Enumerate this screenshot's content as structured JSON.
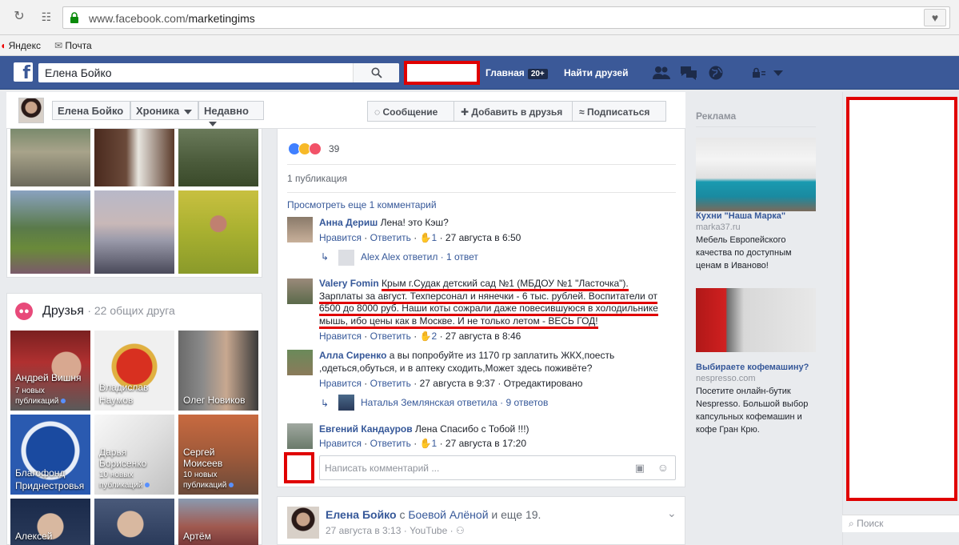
{
  "browser": {
    "url_prefix": "www.facebook.com/",
    "url_path": "marketingims",
    "bookmarks": [
      "Яндекс",
      "Почта"
    ]
  },
  "fb": {
    "search_value": "Елена Бойко",
    "nav_home": "Главная",
    "nav_home_badge": "20+",
    "nav_find_friends": "Найти друзей"
  },
  "profile": {
    "name": "Елена Бойко",
    "timeline_label": "Хроника",
    "recent_label": "Недавно",
    "message_btn": "Сообщение",
    "add_friend_btn": "Добавить в друзья",
    "follow_btn": "Подписаться"
  },
  "friends": {
    "title": "Друзья",
    "common": "· 22 общих друга",
    "tiles": [
      {
        "name": "Андрей Вишня",
        "sub1": "7 новых",
        "sub2": "публикаций"
      },
      {
        "name": "Владислав",
        "name2": "Наумов",
        "sub1": "",
        "sub2": ""
      },
      {
        "name": "Олег Новиков",
        "sub1": "",
        "sub2": ""
      },
      {
        "name": "Благофонд",
        "name2": "Приднестровья",
        "sub1": "",
        "sub2": ""
      },
      {
        "name": "Дарья",
        "name2": "Борисенко",
        "sub1": "10 новых",
        "sub2": "публикаций"
      },
      {
        "name": "Сергей",
        "name2": "Моисеев",
        "sub1": "10 новых",
        "sub2": "публикаций"
      },
      {
        "name": "Алексей",
        "sub1": "",
        "sub2": ""
      },
      {
        "name": "",
        "sub1": "",
        "sub2": ""
      },
      {
        "name": "Артём",
        "sub1": "",
        "sub2": ""
      }
    ]
  },
  "post": {
    "reactions_count": "39",
    "shares": "1 публикация",
    "view_more": "Просмотреть еще 1 комментарий",
    "comments": [
      {
        "author": "Анна Дериш",
        "text": "Лена! это Кэш?",
        "meta_like": "Нравится",
        "meta_reply": "Ответить",
        "likes": "1",
        "time": "27 августа в 6:50"
      },
      {
        "author": "Valery Fomin",
        "line1": "Крым г.Судак детский сад №1 (МБДОУ №1 \"Ласточка\").",
        "line2": "Зарплаты за август. Техперсонал и нянечки - 6 тыс. рублей. Воспитатели от",
        "line3": "6500 до 8000 руб. Наши коты сожрали даже повесившуюся в холодильнике",
        "line4": "мышь, ибо цены как в Москве. И не только летом - ВЕСЬ ГОД!",
        "meta_like": "Нравится",
        "meta_reply": "Ответить",
        "likes": "2",
        "time": "27 августа в 8:46"
      },
      {
        "author": "Алла Сиренко",
        "line1": "а вы попробуйте из 1170 гр заплатить ЖКХ,поесть",
        "line2": ",одеться,обуться, и в аптеку сходить,Может здесь поживёте?",
        "meta_like": "Нравится",
        "meta_reply": "Ответить",
        "time": "27 августа в 9:37",
        "edited": "Отредактировано"
      },
      {
        "author": "Евгений Кандауров",
        "text": "Лена Спасибо с Тобой !!!)",
        "meta_like": "Нравится",
        "meta_reply": "Ответить",
        "likes": "1",
        "time": "27 августа в 17:20"
      }
    ],
    "reply1": {
      "author": "Alex Alex ответил",
      "count": "· 1 ответ"
    },
    "reply2": {
      "author": "Наталья Землянская ответила",
      "count": "· 9 ответов"
    },
    "comment_placeholder": "Написать комментарий ..."
  },
  "post2": {
    "author": "Елена Бойко",
    "with": "с",
    "with_who": "Боевой Алёной",
    "and_more": "и еще 19.",
    "time": "27 августа в 3:13",
    "via": "· YouTube ·"
  },
  "ads": {
    "header": "Реклама",
    "items": [
      {
        "title": "Кухни \"Наша Марка\"",
        "url": "marka37.ru",
        "desc": [
          "Мебель Европейского",
          "качества по доступным",
          "ценам в Иваново!"
        ]
      },
      {
        "title": "Выбираете кофемашину?",
        "url": "nespresso.com",
        "desc": [
          "Посетите онлайн-бутик",
          "Nespresso. Большой выбор",
          "капсульных кофемашин и",
          "кофе Гран Крю."
        ]
      }
    ]
  },
  "right_search": "Поиск",
  "colors": {
    "fb_blue": "#3b5998",
    "link": "#365899",
    "red_box": "#e00000"
  }
}
